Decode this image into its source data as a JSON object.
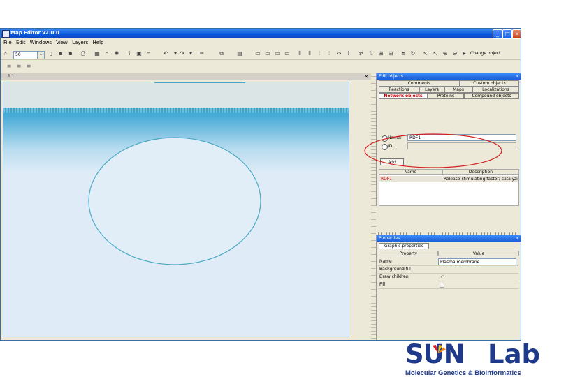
{
  "window": {
    "title": "Map Editor v2.0.0"
  },
  "menu": [
    "File",
    "Edit",
    "Windows",
    "View",
    "Layers",
    "Help"
  ],
  "toolbar": {
    "zoom_value": "50",
    "change_label": "Change object"
  },
  "canvas_panel": {
    "title": "1 1"
  },
  "edit_objects": {
    "title": "Edit objects",
    "tabs_row1": [
      "Comments",
      "Custom objects"
    ],
    "tabs_row2": [
      "Reactions",
      "Layers",
      "Maps",
      "Localizations"
    ],
    "tabs_row3": [
      "Network objects",
      "Proteins",
      "Compound objects"
    ],
    "selected_tab": "Network objects",
    "name_label": "Name:",
    "name_value": "RDF1",
    "id_label": "ID:",
    "id_value": "",
    "add_button": "Add",
    "columns": [
      "Name",
      "Description"
    ],
    "rows": [
      {
        "name": "RDF1",
        "description": "Release-stimulating factor; catalyzing fa"
      }
    ]
  },
  "properties": {
    "title": "Properties",
    "section": "Graphic properties",
    "columns": [
      "Property",
      "Value"
    ],
    "rows": [
      {
        "property": "Name",
        "value": "Plasma membrane",
        "type": "text"
      },
      {
        "property": "Background fill",
        "value": "",
        "type": "text"
      },
      {
        "property": "Draw children",
        "value": "✓",
        "type": "check"
      },
      {
        "property": "Fill",
        "value": "",
        "type": "check"
      }
    ]
  },
  "logo": {
    "text_sun": "SUN",
    "text_lab": "Lab",
    "tagline": "Molecular Genetics & Bioinformatics"
  },
  "colors": {
    "accent": "#0a55d8",
    "highlight_ellipse": "#d42020",
    "membrane": "#4aa8c4"
  }
}
